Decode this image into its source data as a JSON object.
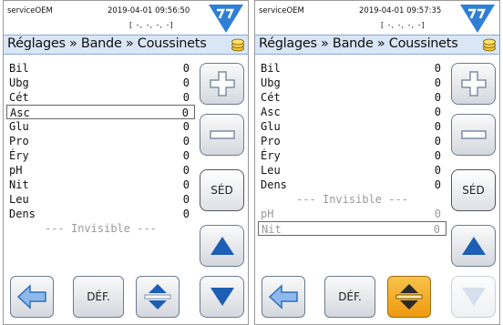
{
  "screens": [
    {
      "user": "serviceOEM",
      "datetime": "2019-04-01  09:56:50",
      "coords": "[ -, -, -, -]",
      "breadcrumb": "Réglages » Bande » Coussinets",
      "rows": [
        {
          "label": "Bil",
          "value": "0"
        },
        {
          "label": "Ubg",
          "value": "0"
        },
        {
          "label": "Cét",
          "value": "0"
        },
        {
          "label": "Asc",
          "value": "0"
        },
        {
          "label": "Glu",
          "value": "0"
        },
        {
          "label": "Pro",
          "value": "0"
        },
        {
          "label": "Éry",
          "value": "0"
        },
        {
          "label": "pH",
          "value": "0"
        },
        {
          "label": "Nit",
          "value": "0"
        },
        {
          "label": "Leu",
          "value": "0"
        },
        {
          "label": "Dens",
          "value": "0"
        }
      ],
      "invisible_label": "--- Invisible ---",
      "hidden_rows": [],
      "buttons": {
        "sed": "SÉD",
        "def": "DÉF."
      }
    },
    {
      "user": "serviceOEM",
      "datetime": "2019-04-01  09:57:35",
      "coords": "[ -, -, -, -]",
      "breadcrumb": "Réglages » Bande » Coussinets",
      "rows": [
        {
          "label": "Bil",
          "value": "0"
        },
        {
          "label": "Ubg",
          "value": "0"
        },
        {
          "label": "Cét",
          "value": "0"
        },
        {
          "label": "Asc",
          "value": "0"
        },
        {
          "label": "Glu",
          "value": "0"
        },
        {
          "label": "Pro",
          "value": "0"
        },
        {
          "label": "Éry",
          "value": "0"
        },
        {
          "label": "Leu",
          "value": "0"
        },
        {
          "label": "Dens",
          "value": "0"
        }
      ],
      "invisible_label": "--- Invisible ---",
      "hidden_rows": [
        {
          "label": "pH",
          "value": "0"
        },
        {
          "label": "Nit",
          "value": "0"
        }
      ],
      "buttons": {
        "sed": "SÉD",
        "def": "DÉF."
      }
    }
  ],
  "colors": {
    "accent_blue": "#2f7fd6",
    "header_band": "#d9e6f6",
    "active_orange": "#ee9a10",
    "muted_text": "#9a9a9a"
  }
}
